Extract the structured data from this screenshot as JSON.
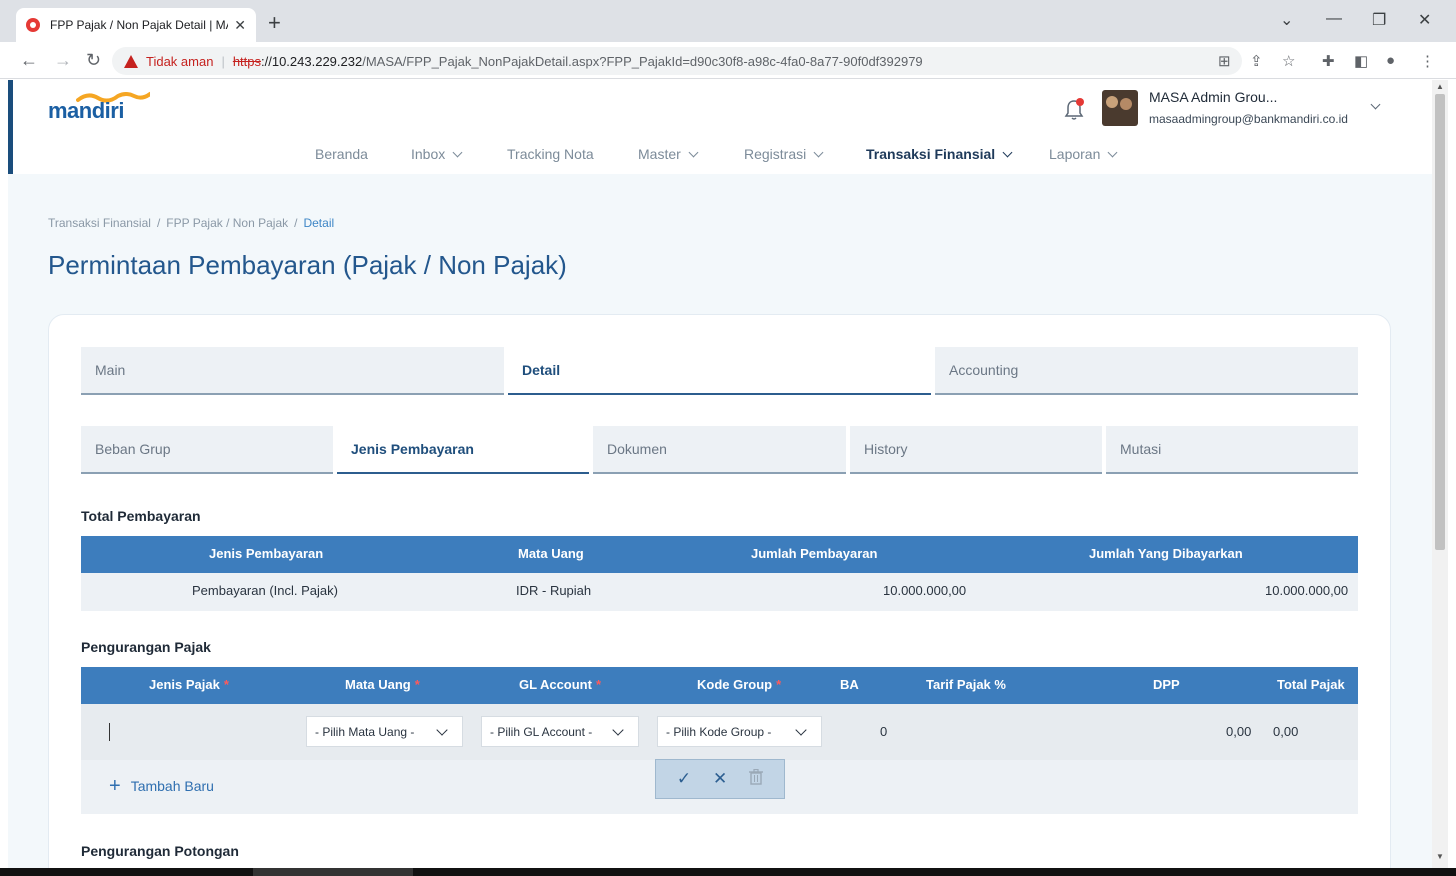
{
  "browser": {
    "tab_title": "FPP Pajak / Non Pajak Detail | MA",
    "security_label": "Tidak aman",
    "url_scheme": "https",
    "url_host": "://10.243.229.232",
    "url_path": "/MASA/FPP_Pajak_NonPajakDetail.aspx?FPP_PajakId=d90c30f8-a98c-4fa0-8a77-90f0df392979"
  },
  "header": {
    "logo_text": "mandiri",
    "user_name": "MASA Admin Grou...",
    "user_email": "masaadmingroup@bankmandiri.co.id"
  },
  "nav": {
    "items": [
      "Beranda",
      "Inbox",
      "Tracking Nota",
      "Master",
      "Registrasi",
      "Transaksi Finansial",
      "Laporan"
    ]
  },
  "breadcrumb": [
    "Transaksi Finansial",
    "FPP Pajak / Non Pajak",
    "Detail"
  ],
  "page_title": "Permintaan Pembayaran (Pajak / Non Pajak)",
  "tabs_main": [
    "Main",
    "Detail",
    "Accounting"
  ],
  "tabs_detail": [
    "Beban Grup",
    "Jenis Pembayaran",
    "Dokumen",
    "History",
    "Mutasi"
  ],
  "total_pembayaran": {
    "title": "Total Pembayaran",
    "headers": [
      "Jenis Pembayaran",
      "Mata Uang",
      "Jumlah Pembayaran",
      "Jumlah Yang Dibayarkan"
    ],
    "row": [
      "Pembayaran (Incl. Pajak)",
      "IDR - Rupiah",
      "10.000.000,00",
      "10.000.000,00"
    ]
  },
  "pengurangan_pajak": {
    "title": "Pengurangan Pajak",
    "headers": [
      "Jenis Pajak",
      "Mata Uang",
      "GL Account",
      "Kode Group",
      "BA",
      "Tarif Pajak %",
      "DPP",
      "Total Pajak"
    ],
    "required_mark": "*",
    "select_mata_uang": "- Pilih Mata Uang -",
    "select_gl_account": "- Pilih GL Account -",
    "select_kode_group": "- Pilih Kode Group -",
    "ba_value": "0",
    "dpp_value": "0,00",
    "total_pajak_value": "0,00",
    "add_label": "Tambah Baru"
  },
  "pengurangan_potongan": {
    "title": "Pengurangan Potongan"
  },
  "colors": {
    "table_header": "#3d7dbd",
    "title_blue": "#23578d",
    "page_bg": "#f3f8fb"
  }
}
